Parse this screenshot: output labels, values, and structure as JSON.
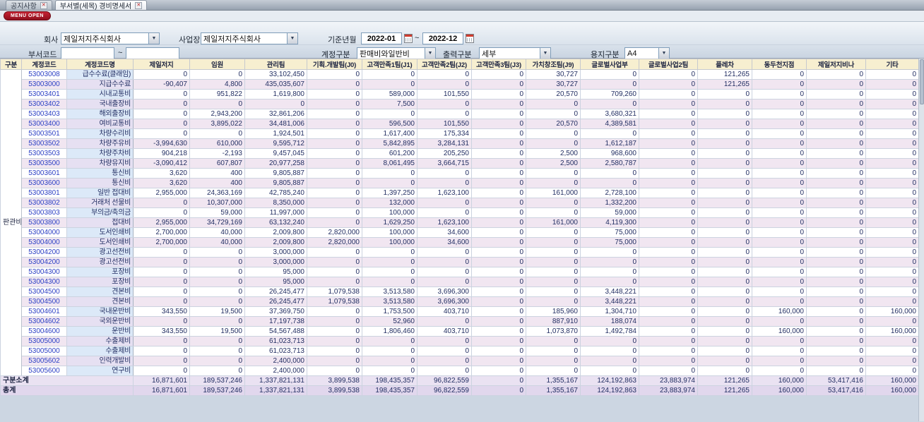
{
  "tabs": [
    {
      "label": "공지사항"
    },
    {
      "label": "부서별(세목) 경비명세서"
    }
  ],
  "menu_button": "MENU OPEN",
  "filters": {
    "company_label": "회사",
    "company_value": "제일저지주식회사",
    "site_label": "사업장",
    "site_value": "제일저지주식회사",
    "period_label": "기준년월",
    "period_from": "2022-01",
    "period_to": "2022-12",
    "tilde": "~",
    "dept_label": "부서코드",
    "dept_from": "",
    "dept_to": "",
    "account_label": "계정구분",
    "account_value": "판매비와일반비",
    "output_label": "출력구분",
    "output_value": "세부",
    "paper_label": "용지구분",
    "paper_value": "A4"
  },
  "table": {
    "columns": [
      "구분",
      "계정코드",
      "계정코드명",
      "제일저지",
      "임원",
      "관리팀",
      "기획.개발팀(J0)",
      "고객만족1팀(J1)",
      "고객만족2팀(J2)",
      "고객만족3팀(J3)",
      "가치창조팀(J9)",
      "글로벌사업부",
      "글로벌사업2팀",
      "플레차",
      "동두천지점",
      "제일저지비나",
      "기타"
    ],
    "group_label": "판관비",
    "rows": [
      {
        "code": "53003008",
        "name": "급수수료(클래임)",
        "values": [
          "0",
          "0",
          "33,102,450",
          "0",
          "0",
          "0",
          "0",
          "30,727",
          "0",
          "0",
          "121,265",
          "0",
          "0",
          "0"
        ]
      },
      {
        "code": "53003000",
        "name": "지급수수료",
        "values": [
          "-90,407",
          "4,800",
          "435,035,607",
          "0",
          "0",
          "0",
          "0",
          "30,727",
          "0",
          "0",
          "121,265",
          "0",
          "0",
          "0"
        ]
      },
      {
        "code": "53003401",
        "name": "시내교통비",
        "values": [
          "0",
          "951,822",
          "1,619,800",
          "0",
          "589,000",
          "101,550",
          "0",
          "20,570",
          "709,260",
          "0",
          "0",
          "0",
          "0",
          "0"
        ]
      },
      {
        "code": "53003402",
        "name": "국내출장비",
        "values": [
          "0",
          "0",
          "0",
          "0",
          "7,500",
          "0",
          "0",
          "0",
          "0",
          "0",
          "0",
          "0",
          "0",
          "0"
        ]
      },
      {
        "code": "53003403",
        "name": "해외출장비",
        "values": [
          "0",
          "2,943,200",
          "32,861,206",
          "0",
          "0",
          "0",
          "0",
          "0",
          "3,680,321",
          "0",
          "0",
          "0",
          "0",
          "0"
        ]
      },
      {
        "code": "53003400",
        "name": "여비교통비",
        "values": [
          "0",
          "3,895,022",
          "34,481,006",
          "0",
          "596,500",
          "101,550",
          "0",
          "20,570",
          "4,389,581",
          "0",
          "0",
          "0",
          "0",
          "0"
        ]
      },
      {
        "code": "53003501",
        "name": "차량수리비",
        "values": [
          "0",
          "0",
          "1,924,501",
          "0",
          "1,617,400",
          "175,334",
          "0",
          "0",
          "0",
          "0",
          "0",
          "0",
          "0",
          "0"
        ]
      },
      {
        "code": "53003502",
        "name": "차량주유비",
        "values": [
          "-3,994,630",
          "610,000",
          "9,595,712",
          "0",
          "5,842,895",
          "3,284,131",
          "0",
          "0",
          "1,612,187",
          "0",
          "0",
          "0",
          "0",
          "0"
        ]
      },
      {
        "code": "53003503",
        "name": "차량주차비",
        "values": [
          "904,218",
          "-2,193",
          "9,457,045",
          "0",
          "601,200",
          "205,250",
          "0",
          "2,500",
          "968,600",
          "0",
          "0",
          "0",
          "0",
          "0"
        ]
      },
      {
        "code": "53003500",
        "name": "차량유지비",
        "values": [
          "-3,090,412",
          "607,807",
          "20,977,258",
          "0",
          "8,061,495",
          "3,664,715",
          "0",
          "2,500",
          "2,580,787",
          "0",
          "0",
          "0",
          "0",
          "0"
        ]
      },
      {
        "code": "53003601",
        "name": "통신비",
        "values": [
          "3,620",
          "400",
          "9,805,887",
          "0",
          "0",
          "0",
          "0",
          "0",
          "0",
          "0",
          "0",
          "0",
          "0",
          "0"
        ]
      },
      {
        "code": "53003600",
        "name": "통신비",
        "values": [
          "3,620",
          "400",
          "9,805,887",
          "0",
          "0",
          "0",
          "0",
          "0",
          "0",
          "0",
          "0",
          "0",
          "0",
          "0"
        ]
      },
      {
        "code": "53003801",
        "name": "일반 접대비",
        "values": [
          "2,955,000",
          "24,363,169",
          "42,785,240",
          "0",
          "1,397,250",
          "1,623,100",
          "0",
          "161,000",
          "2,728,100",
          "0",
          "0",
          "0",
          "0",
          "0"
        ]
      },
      {
        "code": "53003802",
        "name": "거래처 선물비",
        "values": [
          "0",
          "10,307,000",
          "8,350,000",
          "0",
          "132,000",
          "0",
          "0",
          "0",
          "1,332,200",
          "0",
          "0",
          "0",
          "0",
          "0"
        ]
      },
      {
        "code": "53003803",
        "name": "부의금/축의금",
        "values": [
          "0",
          "59,000",
          "11,997,000",
          "0",
          "100,000",
          "0",
          "0",
          "0",
          "59,000",
          "0",
          "0",
          "0",
          "0",
          "0"
        ]
      },
      {
        "code": "53003800",
        "name": "접대비",
        "values": [
          "2,955,000",
          "34,729,169",
          "63,132,240",
          "0",
          "1,629,250",
          "1,623,100",
          "0",
          "161,000",
          "4,119,300",
          "0",
          "0",
          "0",
          "0",
          "0"
        ]
      },
      {
        "code": "53004000",
        "name": "도서인쇄비",
        "values": [
          "2,700,000",
          "40,000",
          "2,009,800",
          "2,820,000",
          "100,000",
          "34,600",
          "0",
          "0",
          "75,000",
          "0",
          "0",
          "0",
          "0",
          "0"
        ]
      },
      {
        "code": "53004000",
        "name": "도서인쇄비",
        "values": [
          "2,700,000",
          "40,000",
          "2,009,800",
          "2,820,000",
          "100,000",
          "34,600",
          "0",
          "0",
          "75,000",
          "0",
          "0",
          "0",
          "0",
          "0"
        ]
      },
      {
        "code": "53004200",
        "name": "광고선전비",
        "values": [
          "0",
          "0",
          "3,000,000",
          "0",
          "0",
          "0",
          "0",
          "0",
          "0",
          "0",
          "0",
          "0",
          "0",
          "0"
        ]
      },
      {
        "code": "53004200",
        "name": "광고선전비",
        "values": [
          "0",
          "0",
          "3,000,000",
          "0",
          "0",
          "0",
          "0",
          "0",
          "0",
          "0",
          "0",
          "0",
          "0",
          "0"
        ]
      },
      {
        "code": "53004300",
        "name": "포장비",
        "values": [
          "0",
          "0",
          "95,000",
          "0",
          "0",
          "0",
          "0",
          "0",
          "0",
          "0",
          "0",
          "0",
          "0",
          "0"
        ]
      },
      {
        "code": "53004300",
        "name": "포장비",
        "values": [
          "0",
          "0",
          "95,000",
          "0",
          "0",
          "0",
          "0",
          "0",
          "0",
          "0",
          "0",
          "0",
          "0",
          "0"
        ]
      },
      {
        "code": "53004500",
        "name": "견본비",
        "values": [
          "0",
          "0",
          "26,245,477",
          "1,079,538",
          "3,513,580",
          "3,696,300",
          "0",
          "0",
          "3,448,221",
          "0",
          "0",
          "0",
          "0",
          "0"
        ]
      },
      {
        "code": "53004500",
        "name": "견본비",
        "values": [
          "0",
          "0",
          "26,245,477",
          "1,079,538",
          "3,513,580",
          "3,696,300",
          "0",
          "0",
          "3,448,221",
          "0",
          "0",
          "0",
          "0",
          "0"
        ]
      },
      {
        "code": "53004601",
        "name": "국내운반비",
        "values": [
          "343,550",
          "19,500",
          "37,369,750",
          "0",
          "1,753,500",
          "403,710",
          "0",
          "185,960",
          "1,304,710",
          "0",
          "0",
          "160,000",
          "0",
          "160,000"
        ]
      },
      {
        "code": "53004602",
        "name": "국외운반비",
        "values": [
          "0",
          "0",
          "17,197,738",
          "0",
          "52,960",
          "0",
          "0",
          "887,910",
          "188,074",
          "0",
          "0",
          "0",
          "0",
          "0"
        ]
      },
      {
        "code": "53004600",
        "name": "운반비",
        "values": [
          "343,550",
          "19,500",
          "54,567,488",
          "0",
          "1,806,460",
          "403,710",
          "0",
          "1,073,870",
          "1,492,784",
          "0",
          "0",
          "160,000",
          "0",
          "160,000"
        ]
      },
      {
        "code": "53005000",
        "name": "수출제비",
        "values": [
          "0",
          "0",
          "61,023,713",
          "0",
          "0",
          "0",
          "0",
          "0",
          "0",
          "0",
          "0",
          "0",
          "0",
          "0"
        ]
      },
      {
        "code": "53005000",
        "name": "수출제비",
        "values": [
          "0",
          "0",
          "61,023,713",
          "0",
          "0",
          "0",
          "0",
          "0",
          "0",
          "0",
          "0",
          "0",
          "0",
          "0"
        ]
      },
      {
        "code": "53005602",
        "name": "인력개발비",
        "values": [
          "0",
          "0",
          "2,400,000",
          "0",
          "0",
          "0",
          "0",
          "0",
          "0",
          "0",
          "0",
          "0",
          "0",
          "0"
        ]
      },
      {
        "code": "53005600",
        "name": "연구비",
        "values": [
          "0",
          "0",
          "2,400,000",
          "0",
          "0",
          "0",
          "0",
          "0",
          "0",
          "0",
          "0",
          "0",
          "0",
          "0"
        ]
      }
    ],
    "subtotal": {
      "label": "구분소계",
      "values": [
        "16,871,601",
        "189,537,246",
        "1,337,821,131",
        "3,899,538",
        "198,435,357",
        "96,822,559",
        "0",
        "1,355,167",
        "124,192,863",
        "23,883,974",
        "121,265",
        "160,000",
        "53,417,416",
        "160,000"
      ]
    },
    "total": {
      "label": "총계",
      "values": [
        "16,871,601",
        "189,537,246",
        "1,337,821,131",
        "3,899,538",
        "198,435,357",
        "96,822,559",
        "0",
        "1,355,167",
        "124,192,863",
        "23,883,974",
        "121,265",
        "160,000",
        "53,417,416",
        "160,000"
      ]
    }
  }
}
